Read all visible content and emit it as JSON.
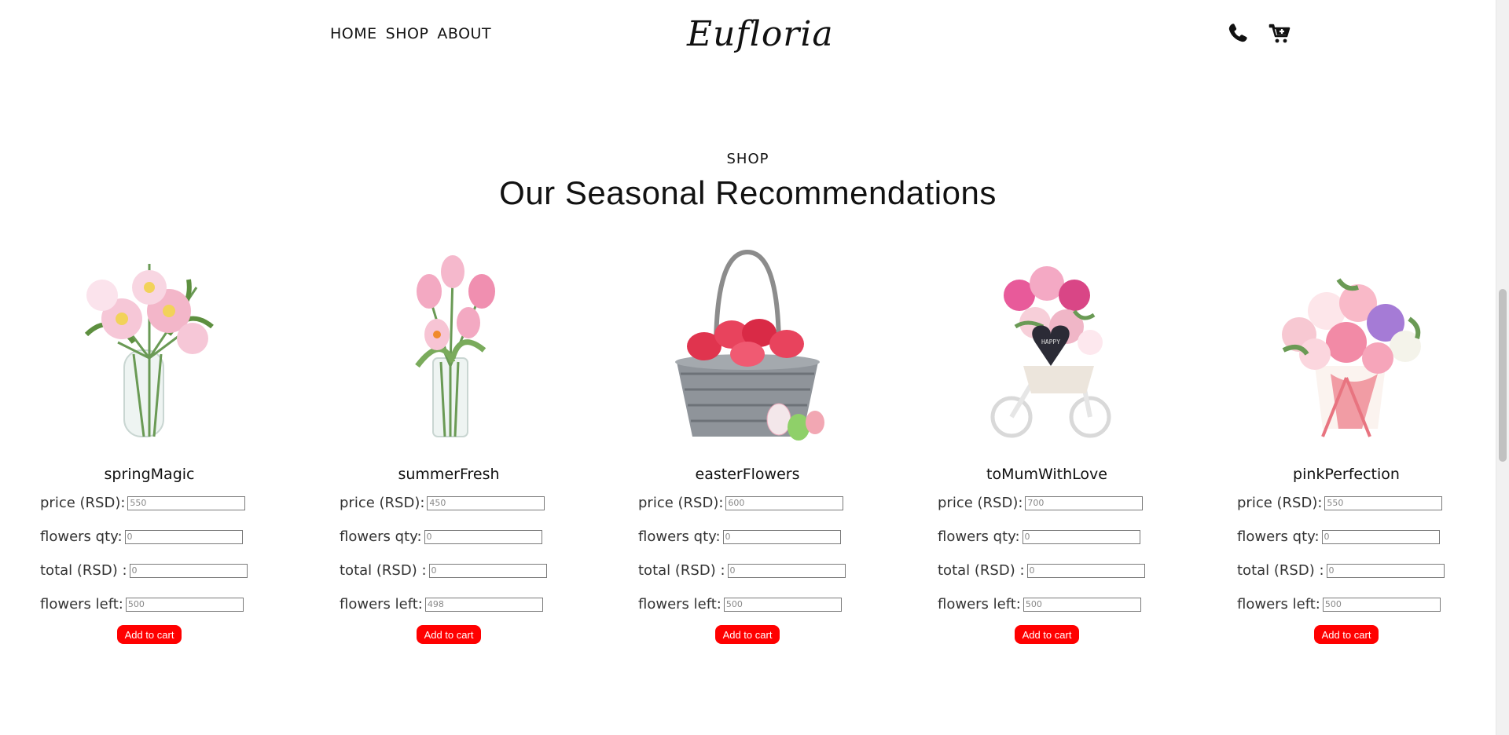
{
  "header": {
    "nav": [
      "HOME",
      "SHOP",
      "ABOUT"
    ],
    "logo": "Eufloria",
    "icons": [
      "phone-icon",
      "cart-plus-icon"
    ]
  },
  "section": {
    "kicker": "SHOP",
    "title": "Our Seasonal Recommendations"
  },
  "labels": {
    "price": "price (RSD):",
    "qty": "flowers qty:",
    "total": "total (RSD) :",
    "left": "flowers left:",
    "button": "Add to cart"
  },
  "products": [
    {
      "name": "springMagic",
      "price": "550",
      "qty": "0",
      "total": "0",
      "left": "500",
      "image": "pink-lily-vase"
    },
    {
      "name": "summerFresh",
      "price": "450",
      "qty": "0",
      "total": "0",
      "left": "498",
      "image": "pink-tulip-vase"
    },
    {
      "name": "easterFlowers",
      "price": "600",
      "qty": "0",
      "total": "0",
      "left": "500",
      "image": "tulip-basket-eggs"
    },
    {
      "name": "toMumWithLove",
      "price": "700",
      "qty": "0",
      "total": "0",
      "left": "500",
      "image": "mothers-day-bike"
    },
    {
      "name": "pinkPerfection",
      "price": "550",
      "qty": "0",
      "total": "0",
      "left": "500",
      "image": "pink-bouquet-pot"
    }
  ],
  "colors": {
    "button": "#ff0000",
    "text": "#111111"
  }
}
